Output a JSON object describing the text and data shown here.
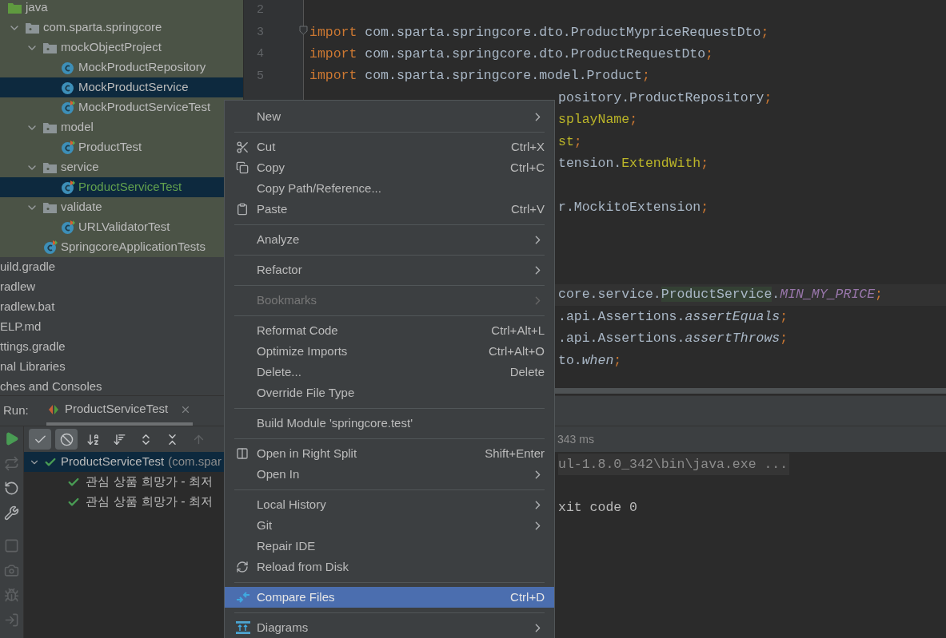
{
  "project_tree": {
    "nodes": [
      {
        "label": "java",
        "kind": "source-folder",
        "added": false,
        "selected": false,
        "children": [
          {
            "label": "com.sparta.springcore",
            "kind": "package",
            "expanded": true,
            "added": false,
            "selected": false,
            "children": [
              {
                "label": "mockObjectProject",
                "kind": "package",
                "expanded": true,
                "added": false,
                "selected": false,
                "children": [
                  {
                    "label": "MockProductRepository",
                    "kind": "class",
                    "added": false,
                    "selected": false
                  },
                  {
                    "label": "MockProductService",
                    "kind": "class",
                    "added": false,
                    "selected": true
                  },
                  {
                    "label": "MockProductServiceTest",
                    "kind": "test-class",
                    "added": false,
                    "selected": false
                  }
                ]
              },
              {
                "label": "model",
                "kind": "package",
                "expanded": true,
                "added": false,
                "selected": false,
                "children": [
                  {
                    "label": "ProductTest",
                    "kind": "test-class",
                    "added": false,
                    "selected": false
                  }
                ]
              },
              {
                "label": "service",
                "kind": "package",
                "expanded": true,
                "added": false,
                "selected": false,
                "children": [
                  {
                    "label": "ProductServiceTest",
                    "kind": "test-class",
                    "added": true,
                    "selected": true
                  }
                ]
              },
              {
                "label": "validate",
                "kind": "package",
                "expanded": true,
                "added": false,
                "selected": false,
                "children": [
                  {
                    "label": "URLValidatorTest",
                    "kind": "test-class",
                    "added": false,
                    "selected": false
                  }
                ]
              },
              {
                "label": "SpringcoreApplicationTests",
                "kind": "test-class",
                "added": false,
                "selected": false
              }
            ]
          }
        ]
      }
    ],
    "files": [
      {
        "label": "uild.gradle"
      },
      {
        "label": "radlew"
      },
      {
        "label": "radlew.bat"
      },
      {
        "label": "ELP.md"
      },
      {
        "label": "ttings.gradle"
      },
      {
        "label": "nal Libraries"
      },
      {
        "label": "ches and Consoles"
      }
    ]
  },
  "editor": {
    "lines": [
      {
        "kind": "code",
        "number": "2"
      },
      {
        "kind": "code",
        "number": "3",
        "tokens": [
          {
            "text": "import ",
            "kind": "keyword"
          },
          {
            "text": "com.sparta.springcore.dto.ProductMypriceRequestDto",
            "kind": "plain"
          },
          {
            "text": ";",
            "kind": "punct"
          }
        ]
      },
      {
        "kind": "code",
        "number": "4",
        "tokens": [
          {
            "text": "import ",
            "kind": "keyword"
          },
          {
            "text": "com.sparta.springcore.dto.ProductRequestDto",
            "kind": "plain"
          },
          {
            "text": ";",
            "kind": "punct"
          }
        ]
      },
      {
        "kind": "code",
        "number": "5",
        "tokens": [
          {
            "text": "import ",
            "kind": "keyword"
          },
          {
            "text": "com.sparta.springcore.model.Product",
            "kind": "plain"
          },
          {
            "text": ";",
            "kind": "punct"
          }
        ]
      },
      {
        "kind": "tail",
        "tokens": [
          {
            "text": "pository.ProductRepository",
            "kind": "plain"
          },
          {
            "text": ";",
            "kind": "punct"
          }
        ]
      },
      {
        "kind": "tail",
        "tokens": [
          {
            "text": "splayName",
            "kind": "annotation"
          },
          {
            "text": ";",
            "kind": "punct"
          }
        ]
      },
      {
        "kind": "tail",
        "tokens": [
          {
            "text": "st",
            "kind": "annotation"
          },
          {
            "text": ";",
            "kind": "punct"
          }
        ]
      },
      {
        "kind": "tail",
        "tokens": [
          {
            "text": "tension.",
            "kind": "plain"
          },
          {
            "text": "ExtendWith",
            "kind": "annotation"
          },
          {
            "text": ";",
            "kind": "punct"
          }
        ]
      },
      {
        "kind": "blank"
      },
      {
        "kind": "tail",
        "tokens": [
          {
            "text": "r.MockitoExtension",
            "kind": "plain"
          },
          {
            "text": ";",
            "kind": "punct"
          }
        ]
      },
      {
        "kind": "blank"
      },
      {
        "kind": "blank"
      },
      {
        "kind": "blank"
      },
      {
        "kind": "current-tail",
        "tokens": [
          {
            "text": "core.service.",
            "kind": "plain"
          },
          {
            "text": "ProductService",
            "kind": "highlight"
          },
          {
            "text": ".",
            "kind": "plain"
          },
          {
            "text": "MIN_MY_PRICE",
            "kind": "static"
          },
          {
            "text": ";",
            "kind": "punct"
          }
        ]
      },
      {
        "kind": "tail",
        "tokens": [
          {
            "text": ".api.Assertions.",
            "kind": "plain"
          },
          {
            "text": "assertEquals",
            "kind": "italic"
          },
          {
            "text": ";",
            "kind": "punct"
          }
        ]
      },
      {
        "kind": "tail",
        "tokens": [
          {
            "text": ".api.Assertions.",
            "kind": "plain"
          },
          {
            "text": "assertThrows",
            "kind": "italic"
          },
          {
            "text": ";",
            "kind": "punct"
          }
        ]
      },
      {
        "kind": "tail",
        "tokens": [
          {
            "text": "to.",
            "kind": "plain"
          },
          {
            "text": "when",
            "kind": "italic"
          },
          {
            "text": ";",
            "kind": "punct"
          }
        ]
      }
    ]
  },
  "run_panel": {
    "label": "Run:",
    "tab": {
      "title": "ProductServiceTest",
      "selected": true
    },
    "side_toolbar": [
      {
        "disabled": false
      },
      {
        "disabled": true
      },
      {
        "disabled": false
      },
      {
        "disabled": false
      },
      {
        "disabled": true
      },
      {
        "disabled": true
      },
      {
        "disabled": true
      },
      {
        "disabled": true
      }
    ],
    "test_toolbar": [
      {
        "on": true,
        "disabled": false
      },
      {
        "on": true,
        "disabled": false
      },
      {
        "on": false,
        "disabled": false
      },
      {
        "on": false,
        "disabled": false
      },
      {
        "on": false,
        "disabled": false
      },
      {
        "on": false,
        "disabled": false
      },
      {
        "on": false,
        "disabled": true
      }
    ],
    "tests": [
      {
        "name": "ProductServiceTest",
        "detail": "(com.spar",
        "passed": true,
        "expanded": true,
        "selected": true,
        "children": [
          {
            "name": "관심 상품 희망가 - 최저",
            "passed": true,
            "selected": false
          },
          {
            "name": "관심 상품 희망가 - 최저",
            "passed": true,
            "selected": false
          }
        ]
      }
    ],
    "console": {
      "status": "343 ms",
      "lines": [
        {
          "kind": "command",
          "text": "ul-1.8.0_342\\bin\\java.exe ..."
        },
        {
          "kind": "blank"
        },
        {
          "kind": "output",
          "text": "xit code 0"
        }
      ]
    }
  },
  "context_menu": {
    "items": [
      {
        "kind": "item",
        "label": "New",
        "submenu": true,
        "disabled": false,
        "selected": false
      },
      {
        "kind": "separator"
      },
      {
        "kind": "item",
        "label": "Cut",
        "shortcut": "Ctrl+X",
        "submenu": false,
        "disabled": false,
        "selected": false
      },
      {
        "kind": "item",
        "label": "Copy",
        "shortcut": "Ctrl+C",
        "submenu": false,
        "disabled": false,
        "selected": false
      },
      {
        "kind": "item",
        "label": "Copy Path/Reference...",
        "submenu": false,
        "disabled": false,
        "selected": false
      },
      {
        "kind": "item",
        "label": "Paste",
        "shortcut": "Ctrl+V",
        "submenu": false,
        "disabled": false,
        "selected": false
      },
      {
        "kind": "separator"
      },
      {
        "kind": "item",
        "label": "Analyze",
        "submenu": true,
        "disabled": false,
        "selected": false
      },
      {
        "kind": "separator"
      },
      {
        "kind": "item",
        "label": "Refactor",
        "submenu": true,
        "disabled": false,
        "selected": false
      },
      {
        "kind": "separator"
      },
      {
        "kind": "item",
        "label": "Bookmarks",
        "submenu": true,
        "disabled": true,
        "selected": false
      },
      {
        "kind": "separator"
      },
      {
        "kind": "item",
        "label": "Reformat Code",
        "shortcut": "Ctrl+Alt+L",
        "submenu": false,
        "disabled": false,
        "selected": false
      },
      {
        "kind": "item",
        "label": "Optimize Imports",
        "shortcut": "Ctrl+Alt+O",
        "submenu": false,
        "disabled": false,
        "selected": false
      },
      {
        "kind": "item",
        "label": "Delete...",
        "shortcut": "Delete",
        "submenu": false,
        "disabled": false,
        "selected": false
      },
      {
        "kind": "item",
        "label": "Override File Type",
        "submenu": false,
        "disabled": false,
        "selected": false
      },
      {
        "kind": "separator"
      },
      {
        "kind": "item",
        "label": "Build Module 'springcore.test'",
        "submenu": false,
        "disabled": false,
        "selected": false
      },
      {
        "kind": "separator"
      },
      {
        "kind": "item",
        "label": "Open in Right Split",
        "shortcut": "Shift+Enter",
        "submenu": false,
        "disabled": false,
        "selected": false
      },
      {
        "kind": "item",
        "label": "Open In",
        "submenu": true,
        "disabled": false,
        "selected": false
      },
      {
        "kind": "separator"
      },
      {
        "kind": "item",
        "label": "Local History",
        "submenu": true,
        "disabled": false,
        "selected": false
      },
      {
        "kind": "item",
        "label": "Git",
        "submenu": true,
        "disabled": false,
        "selected": false
      },
      {
        "kind": "item",
        "label": "Repair IDE",
        "submenu": false,
        "disabled": false,
        "selected": false
      },
      {
        "kind": "item",
        "label": "Reload from Disk",
        "submenu": false,
        "disabled": false,
        "selected": false
      },
      {
        "kind": "separator"
      },
      {
        "kind": "item",
        "label": "Compare Files",
        "shortcut": "Ctrl+D",
        "submenu": false,
        "disabled": false,
        "selected": true
      },
      {
        "kind": "separator"
      },
      {
        "kind": "item",
        "label": "Diagrams",
        "submenu": true,
        "disabled": false,
        "selected": false
      }
    ]
  }
}
